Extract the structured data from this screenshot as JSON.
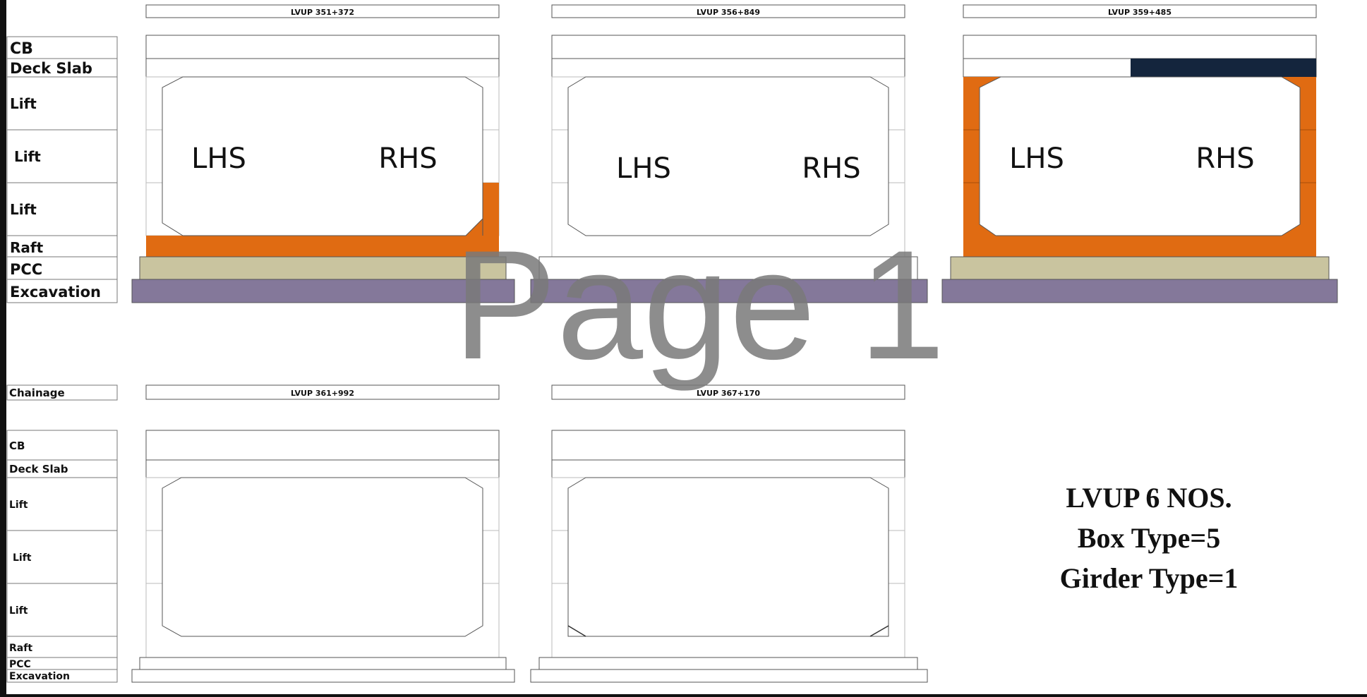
{
  "sheet": {
    "row_labels_top": [
      "CB",
      "Deck Slab",
      "Lift",
      "Lift",
      "Lift",
      "Raft",
      "PCC",
      "Excavation"
    ],
    "row_labels_bottom": [
      "Chainage",
      "CB",
      "Deck Slab",
      "Lift",
      "Lift",
      "Lift",
      "Raft",
      "PCC",
      "Excavation"
    ],
    "boxes": [
      {
        "chainage": "LVUP 351+372",
        "lhs": "LHS",
        "rhs": "RHS"
      },
      {
        "chainage": "LVUP 356+849",
        "lhs": "LHS",
        "rhs": "RHS"
      },
      {
        "chainage": "LVUP 359+485",
        "lhs": "LHS",
        "rhs": "RHS"
      },
      {
        "chainage": "LVUP 361+992",
        "lhs": "",
        "rhs": ""
      },
      {
        "chainage": "LVUP 367+170",
        "lhs": "",
        "rhs": ""
      }
    ],
    "summary": [
      "LVUP 6 NOS.",
      "Box Type=5",
      "Girder Type=1"
    ],
    "watermark": "Page 1"
  },
  "colors": {
    "completed": "#e06b12",
    "pcc": "#c9c49f",
    "excavation": "#84789a",
    "deck_progress": "#14253d",
    "outline": "#555555"
  }
}
